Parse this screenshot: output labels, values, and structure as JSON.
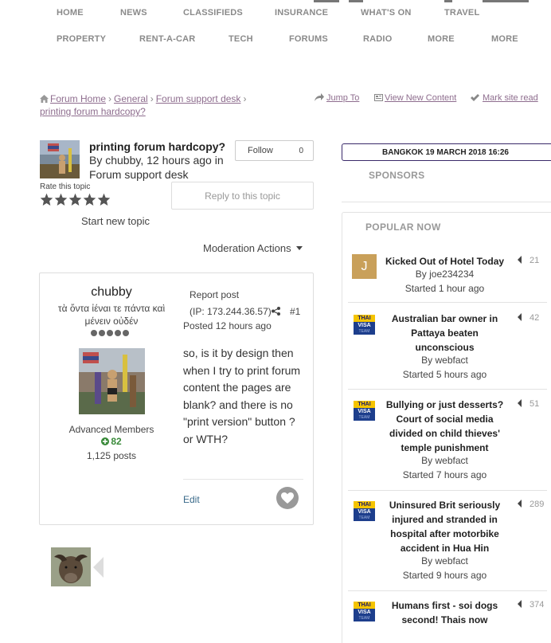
{
  "nav": {
    "row1": [
      "HOME",
      "NEWS",
      "CLASSIFIEDS",
      "INSURANCE",
      "WHAT'S ON",
      "TRAVEL"
    ],
    "row2": [
      "PROPERTY",
      "RENT-A-CAR",
      "TECH",
      "FORUMS",
      "RADIO",
      "MORE",
      "MORE"
    ]
  },
  "breadcrumb": {
    "home": "Forum Home",
    "general": "General",
    "support": "Forum support desk",
    "current": "printing forum hardcopy?"
  },
  "actions": {
    "jump_to": "Jump To",
    "view_new": "View New Content",
    "mark_read": "Mark site read"
  },
  "topic": {
    "title": "printing forum hardcopy?",
    "meta": "By chubby, 12 hours ago in Forum support desk",
    "follow_label": "Follow",
    "follow_count": "0",
    "rate_label": "Rate this topic",
    "reply_label": "Reply to this topic",
    "start_new": "Start new topic",
    "moderation": "Moderation Actions"
  },
  "post": {
    "author": "chubby",
    "motto": "τὰ ὄντα ἰέναι τε πάντα καὶ μένειν οὐδέν",
    "group": "Advanced Members",
    "reputation": "82",
    "posts": "1,125 posts",
    "report": "Report post",
    "ip": "(IP: 173.244.36.57)",
    "number": "#1",
    "date": "Posted 12 hours ago",
    "body": "so, is it by design then when I try to print forum content the pages are blank?  and there is no \"print version\" button ?  or WTH?",
    "edit": "Edit"
  },
  "sidebar": {
    "date_bar": "BANGKOK 19 MARCH 2018 16:26",
    "sponsors": "SPONSORS",
    "popular_title": "POPULAR NOW",
    "items": [
      {
        "title": "Kicked Out of Hotel Today",
        "by": "By joe234234",
        "started": "Started 1 hour ago",
        "count": "21",
        "avatar": "J"
      },
      {
        "title": "Australian bar owner in Pattaya beaten unconscious",
        "by": "By webfact",
        "started": "Started 5 hours ago",
        "count": "42",
        "avatar": "thaivisa"
      },
      {
        "title": "Bullying or just desserts? Court of social media divided on child thieves' temple punishment",
        "by": "By webfact",
        "started": "Started 7 hours ago",
        "count": "51",
        "avatar": "thaivisa"
      },
      {
        "title": "Uninsured Brit seriously injured and stranded in hospital after motorbike accident in Hua Hin",
        "by": "By webfact",
        "started": "Started 9 hours ago",
        "count": "289",
        "avatar": "thaivisa"
      },
      {
        "title": "Humans first - soi dogs second! Thais now",
        "by": "",
        "started": "",
        "count": "374",
        "avatar": "thaivisa"
      }
    ],
    "logo_text": {
      "top": "THAI",
      "mid": "VISA",
      "bottom": "TEAM"
    }
  },
  "colors": {
    "link": "#8e6d8e",
    "rep_green": "#3a8a3a",
    "date_border": "#3a2a6a",
    "logo_yellow": "#f5c400",
    "logo_blue": "#1d3e8c"
  },
  "icons": [
    "home-icon",
    "share-icon",
    "jump-to-icon",
    "view-new-icon",
    "checkmark-icon",
    "heart-icon",
    "star-icon",
    "caret-down-icon",
    "plus-circle-icon",
    "comment-count-icon"
  ]
}
